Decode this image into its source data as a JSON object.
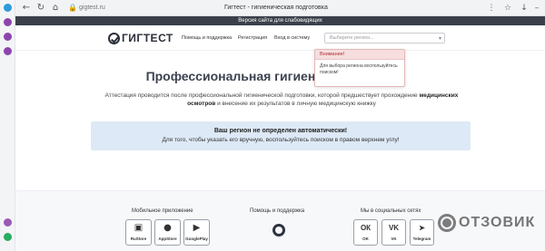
{
  "browser": {
    "url": "gigtest.ru",
    "tab_title": "Гигтест - гигиеническая подготовка",
    "url_icon": "lock-icon",
    "back_icon": "back-arrow-icon",
    "refresh_icon": "refresh-icon",
    "home_icon": "home-icon",
    "star_icon": "star-icon",
    "menu_icon": "menu-icon"
  },
  "sidepanel": {
    "icons": [
      "messenger-icon",
      "telegram-icon",
      "vk-icon",
      "player-icon",
      "settings-icon"
    ]
  },
  "accessibility_bar": {
    "label": "Версия сайта для слабовидящих"
  },
  "header": {
    "logo_text": "ГИГТЕСТ",
    "nav": [
      "Помощь и поддержка",
      "Регистрация",
      "Вход в систему"
    ],
    "region_placeholder": "Выберите регион...",
    "region_caret": "▾"
  },
  "popover": {
    "title": "Внимание!",
    "text": "Для выбора региона воспользуйтесь поиском!"
  },
  "hero": {
    "title": "Профессиональная гигиеническ",
    "desc_before": "Аттестация проводится после профессиональной гигиенической подготовки, которой предшествует прохождение ",
    "desc_bold": "медицинских осмотров",
    "desc_after": " и внесение их результатов в личную медицинскую книжку"
  },
  "info": {
    "title": "Ваш регион не определен автоматически!",
    "text": "Для того, чтобы указать его вручную, воспользуйтесь поиском в правом верхнем углу!"
  },
  "footer": {
    "mobile_heading": "Мобильное приложение",
    "support_heading": "Помощь и поддержка",
    "social_heading": "Мы в социальных сетях",
    "apps": [
      {
        "label": "RuStore",
        "icon": "rustore-icon",
        "glyph": "▣"
      },
      {
        "label": "AppStore",
        "icon": "apple-icon",
        "glyph": "●"
      },
      {
        "label": "GooglePlay",
        "icon": "googleplay-icon",
        "glyph": "▶"
      }
    ],
    "socials": [
      {
        "label": "OK",
        "icon": "ok-icon",
        "glyph": "ОК"
      },
      {
        "label": "VK",
        "icon": "vk-icon",
        "glyph": "VK"
      },
      {
        "label": "Telegram",
        "icon": "telegram-icon",
        "glyph": "➤"
      }
    ]
  },
  "watermark": {
    "text": "ОТЗОВИК"
  }
}
